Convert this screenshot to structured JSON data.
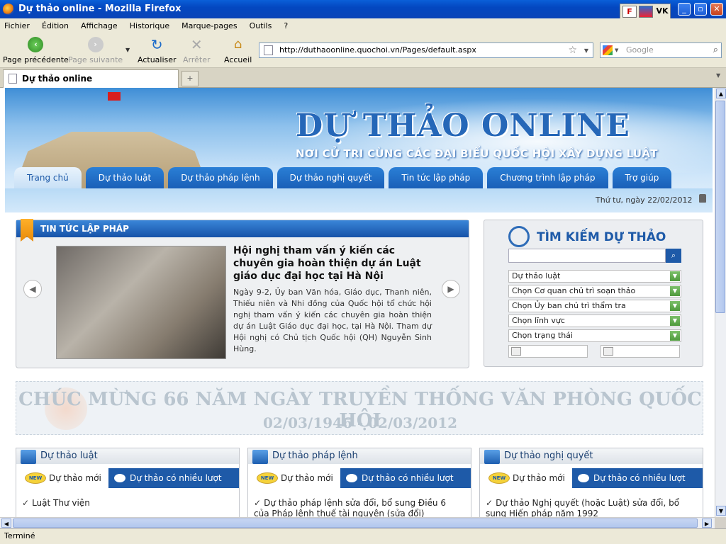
{
  "window": {
    "title": "Dự thảo online - Mozilla Firefox",
    "ext_labels": [
      "F",
      "VK"
    ]
  },
  "menu": [
    "Fichier",
    "Édition",
    "Affichage",
    "Historique",
    "Marque-pages",
    "Outils",
    "?"
  ],
  "nav": {
    "back": "Page précédente",
    "forward": "Page suivante",
    "reload": "Actualiser",
    "stop": "Arrêter",
    "home": "Accueil",
    "url": "http://duthaoonline.quochoi.vn/Pages/default.aspx",
    "search_placeholder": "Google"
  },
  "tabs": {
    "active": "Dự thảo online"
  },
  "status": "Terminé",
  "page": {
    "site_title": "DỰ THẢO ONLINE",
    "site_subtitle": "NƠI CỬ TRI CÙNG CÁC ĐẠI BIỂU QUỐC HỘI XÂY DỰNG LUẬT",
    "main_nav": [
      "Trang chủ",
      "Dự thảo luật",
      "Dự thảo pháp lệnh",
      "Dự thảo nghị quyết",
      "Tin tức lập pháp",
      "Chương trình lập pháp",
      "Trợ giúp"
    ],
    "date": "Thứ tư, ngày 22/02/2012",
    "news": {
      "header": "TIN TỨC LẬP PHÁP",
      "title": "Hội nghị tham vấn ý kiến các chuyên gia hoàn thiện dự án Luật giáo dục đại học tại Hà Nội",
      "body": "Ngày 9-2, Ủy ban Văn hóa, Giáo dục, Thanh niên, Thiếu niên và Nhi đồng của Quốc hội tổ chức hội nghị tham vấn ý kiến các chuyên gia hoàn thiện dự án Luật Giáo dục đại học, tại Hà Nội. Tham dự Hội nghị có Chủ tịch Quốc hội (QH) Nguyễn Sinh Hùng."
    },
    "search": {
      "title": "TÌM KIẾM DỰ THẢO",
      "selects": [
        "Dự thảo luật",
        "Chọn Cơ quan chủ trì soạn thảo",
        "Chọn Ủy ban chủ trì thẩm tra",
        "Chọn lĩnh vực",
        "Chọn trạng thái"
      ]
    },
    "congrats": {
      "line1": "CHÚC MỪNG 66 NĂM NGÀY TRUYỀN THỐNG VĂN PHÒNG QUỐC HỘI",
      "line2": "02/03/1946 - 02/03/2012"
    },
    "categories": [
      {
        "title": "Dự thảo luật",
        "tab_new": "Dự thảo mới",
        "tab_popular": "Dự thảo có nhiều lượt xem",
        "new_badge": "NEW",
        "item": "Luật Thư viện"
      },
      {
        "title": "Dự thảo pháp lệnh",
        "tab_new": "Dự thảo mới",
        "tab_popular": "Dự thảo có nhiều lượt xem",
        "new_badge": "NEW",
        "item": "Dự thảo pháp lệnh sửa đổi, bổ sung Điều 6 của Pháp lệnh thuế tài nguyên (sửa đổi)"
      },
      {
        "title": "Dự thảo nghị quyết",
        "tab_new": "Dự thảo mới",
        "tab_popular": "Dự thảo có nhiều lượt xem",
        "new_badge": "NEW",
        "item": "Dự thảo Nghị quyết (hoặc Luật) sửa đổi, bổ sung Hiến pháp năm 1992"
      }
    ]
  }
}
